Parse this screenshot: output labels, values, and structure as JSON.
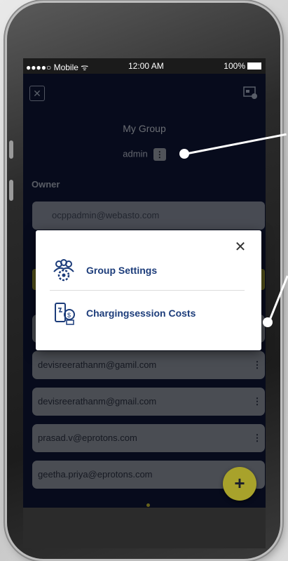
{
  "status_bar": {
    "left": "●●●●○ Mobile  ᯤ",
    "time": "12:00 AM",
    "battery": "100%"
  },
  "header": {
    "title": "My Group",
    "role": "admin"
  },
  "owner": {
    "label": "Owner",
    "email": "ocppadmin@webasto.com"
  },
  "members": [
    {
      "email": "devisreerathanm@gamil.com"
    },
    {
      "email": "devisreerathanm@gmail.com"
    },
    {
      "email": "prasad.v@eprotons.com"
    },
    {
      "email": "geetha.priya@eprotons.com"
    }
  ],
  "menu": {
    "items": [
      {
        "label": "Group Settings",
        "icon": "group-settings-icon"
      },
      {
        "label": "Chargingsession Costs",
        "icon": "charging-cost-icon"
      }
    ]
  },
  "fab": {
    "label": "+"
  },
  "colors": {
    "accent": "#a8a22b",
    "link": "#1c3c7a",
    "screen_bg": "#0d1431"
  }
}
